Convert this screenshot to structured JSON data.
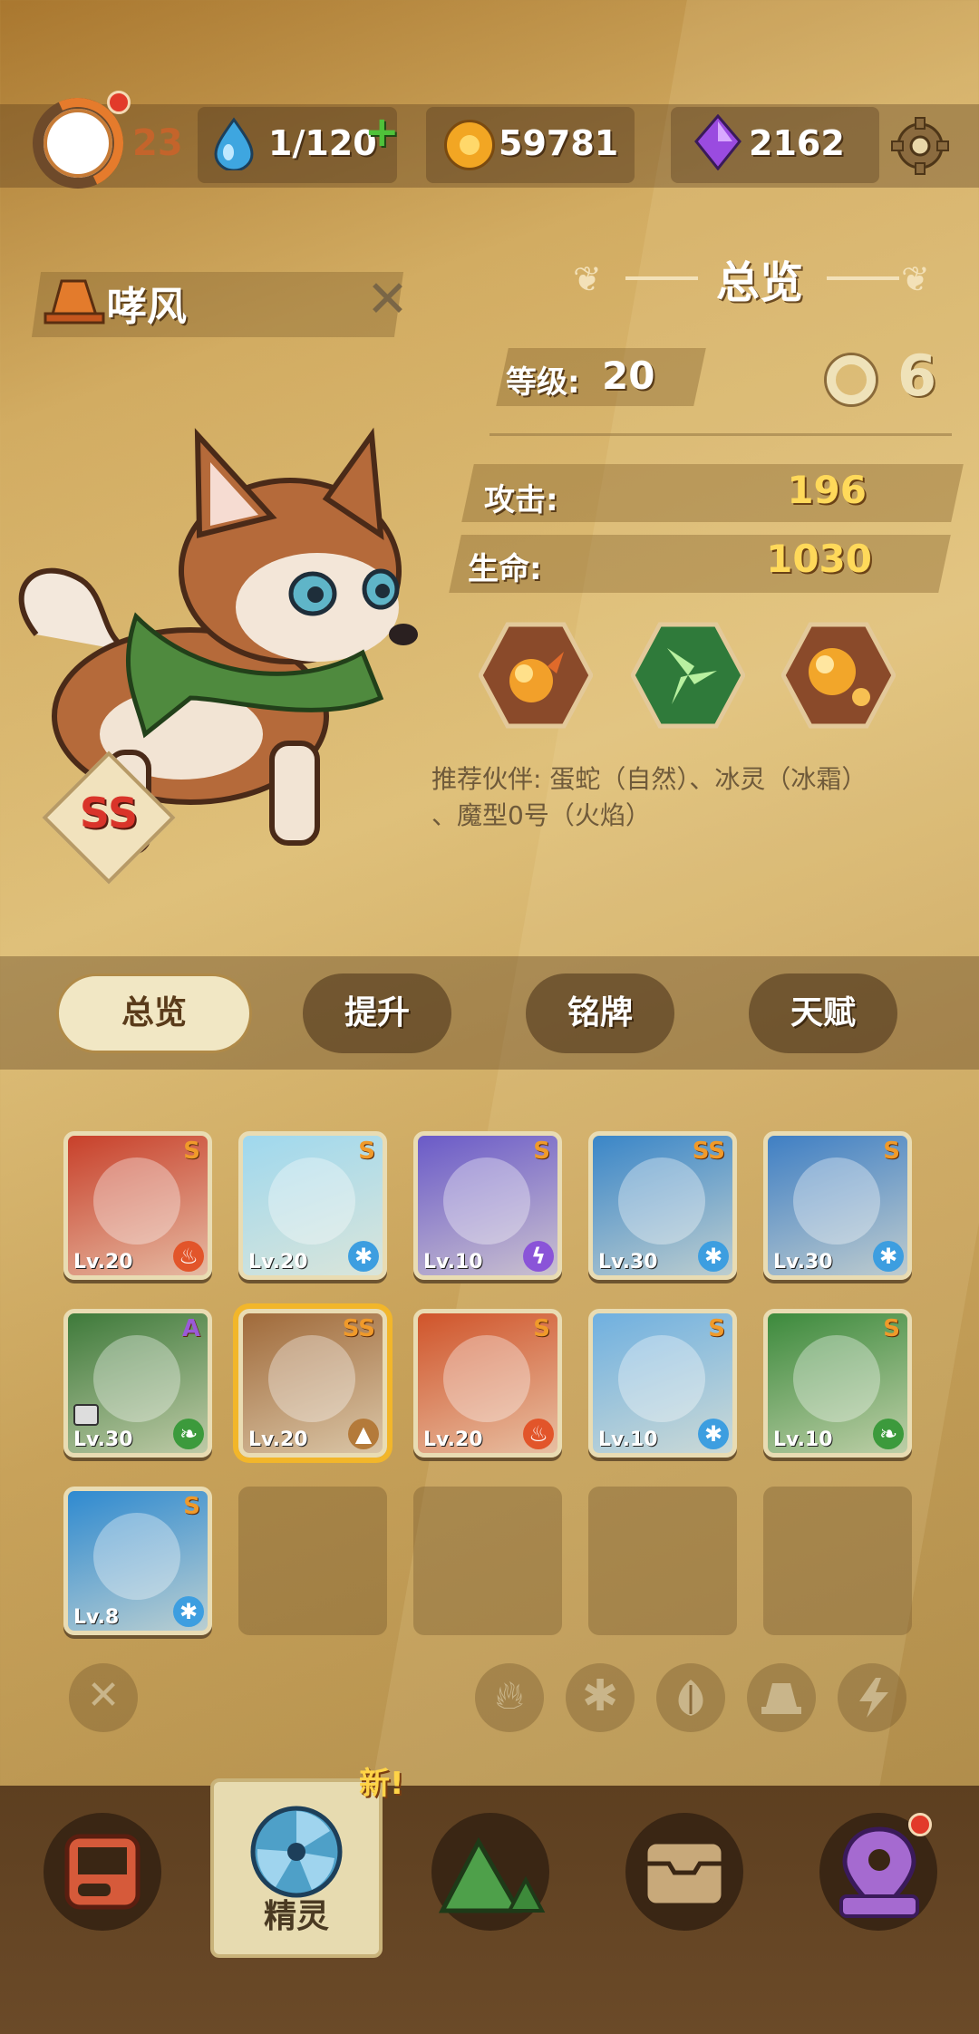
{
  "header": {
    "level": "23",
    "stamina": "1/120",
    "coins": "59781",
    "gems": "2162"
  },
  "pet": {
    "name": "哮风",
    "grade": "SS"
  },
  "overview": {
    "title": "总览",
    "level_label": "等级:",
    "level_value": "20",
    "stars": "6",
    "attack_label": "攻击:",
    "attack_value": "196",
    "hp_label": "生命:",
    "hp_value": "1030",
    "recommend_line1": "推荐伙伴: 蛋蛇（自然）、冰灵（冰霜）",
    "recommend_line2": "、魔型0号（火焰）"
  },
  "tabs": [
    "总览",
    "提升",
    "铭牌",
    "天赋"
  ],
  "pets": [
    {
      "level": "Lv.20",
      "rank": "S",
      "element": "fire",
      "color": "#c8402a"
    },
    {
      "level": "Lv.20",
      "rank": "S",
      "element": "ice",
      "color": "#9fd8ee"
    },
    {
      "level": "Lv.10",
      "rank": "S",
      "element": "thunder",
      "color": "#6a5ac8"
    },
    {
      "level": "Lv.30",
      "rank": "SS",
      "element": "ice",
      "color": "#3a86c8"
    },
    {
      "level": "Lv.30",
      "rank": "S",
      "element": "ice",
      "color": "#3f7fc4"
    },
    {
      "level": "Lv.30",
      "rank": "A",
      "element": "nature",
      "color": "#3e7a3a"
    },
    {
      "level": "Lv.20",
      "rank": "SS",
      "element": "earth",
      "color": "#a06a3a"
    },
    {
      "level": "Lv.20",
      "rank": "S",
      "element": "fire",
      "color": "#d0542a"
    },
    {
      "level": "Lv.10",
      "rank": "S",
      "element": "ice",
      "color": "#6fb0e0"
    },
    {
      "level": "Lv.10",
      "rank": "S",
      "element": "nature",
      "color": "#3c8a3c"
    },
    {
      "level": "Lv.8",
      "rank": "S",
      "element": "ice",
      "color": "#2f8ad0"
    }
  ],
  "nav": {
    "active_label": "精灵",
    "new_badge": "新!"
  },
  "colors": {
    "fire": "#e2552a",
    "ice": "#3d9ee0",
    "thunder": "#8a54d8",
    "nature": "#3c9a3c",
    "earth": "#b47a3a"
  }
}
